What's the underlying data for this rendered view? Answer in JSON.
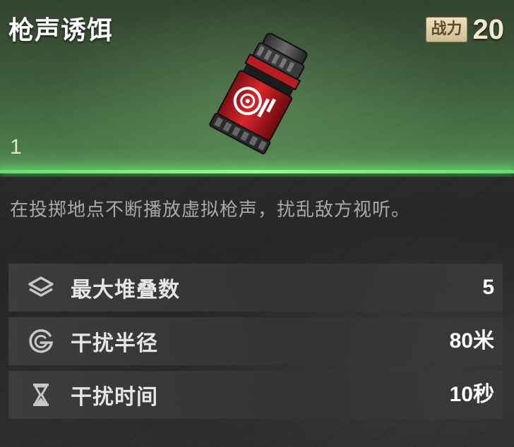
{
  "item": {
    "name": "枪声诱饵",
    "power_label": "战力",
    "power_value": "20",
    "count": "1",
    "icon": "gunshot-decoy-icon"
  },
  "description": "在投掷地点不断播放虚拟枪声，扰乱敌方视听。",
  "stats": [
    {
      "icon": "layers-icon",
      "label": "最大堆叠数",
      "value": "5"
    },
    {
      "icon": "radius-icon",
      "label": "干扰半径",
      "value": "80米"
    },
    {
      "icon": "hourglass-icon",
      "label": "干扰时间",
      "value": "10秒"
    }
  ],
  "colors": {
    "header_green": "#4b7a4a",
    "glow_green": "#8dff8f",
    "power_badge": "#e3d3a8",
    "stat_row": "#3e3e3e",
    "desc_text": "#a9a9a9"
  }
}
